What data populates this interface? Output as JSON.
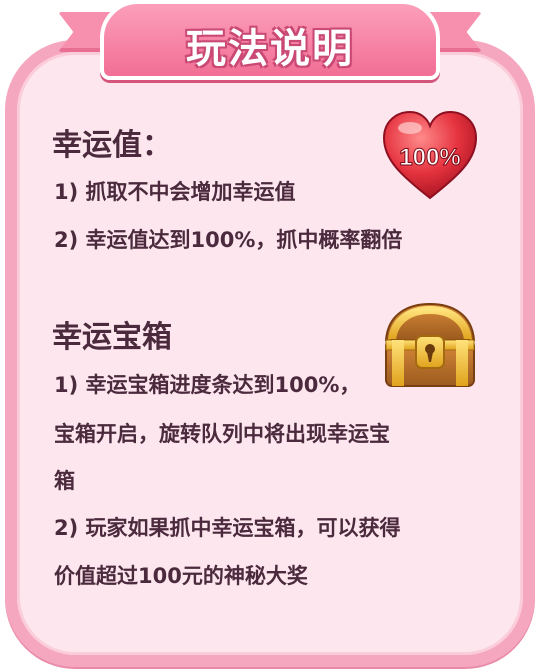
{
  "title": "玩法说明",
  "sections": [
    {
      "heading": "幸运值：",
      "badge_text": "100%",
      "lines": [
        "1) 抓取不中会增加幸运值",
        "2) 幸运值达到100%，抓中概率翻倍"
      ]
    },
    {
      "heading": "幸运宝箱",
      "lines": [
        "1) 幸运宝箱进度条达到100%，",
        "宝箱开启，旋转队列中将出现幸运宝",
        "箱",
        "2) 玩家如果抓中幸运宝箱，可以获得",
        "价值超过100元的神秘大奖"
      ]
    }
  ],
  "icons": {
    "heart": "heart-icon",
    "chest": "treasure-chest-icon"
  },
  "colors": {
    "panel_bg": "#fde6ee",
    "border": "#f6a7c0",
    "ribbon": "#f26e95",
    "text": "#4a2a3c"
  }
}
